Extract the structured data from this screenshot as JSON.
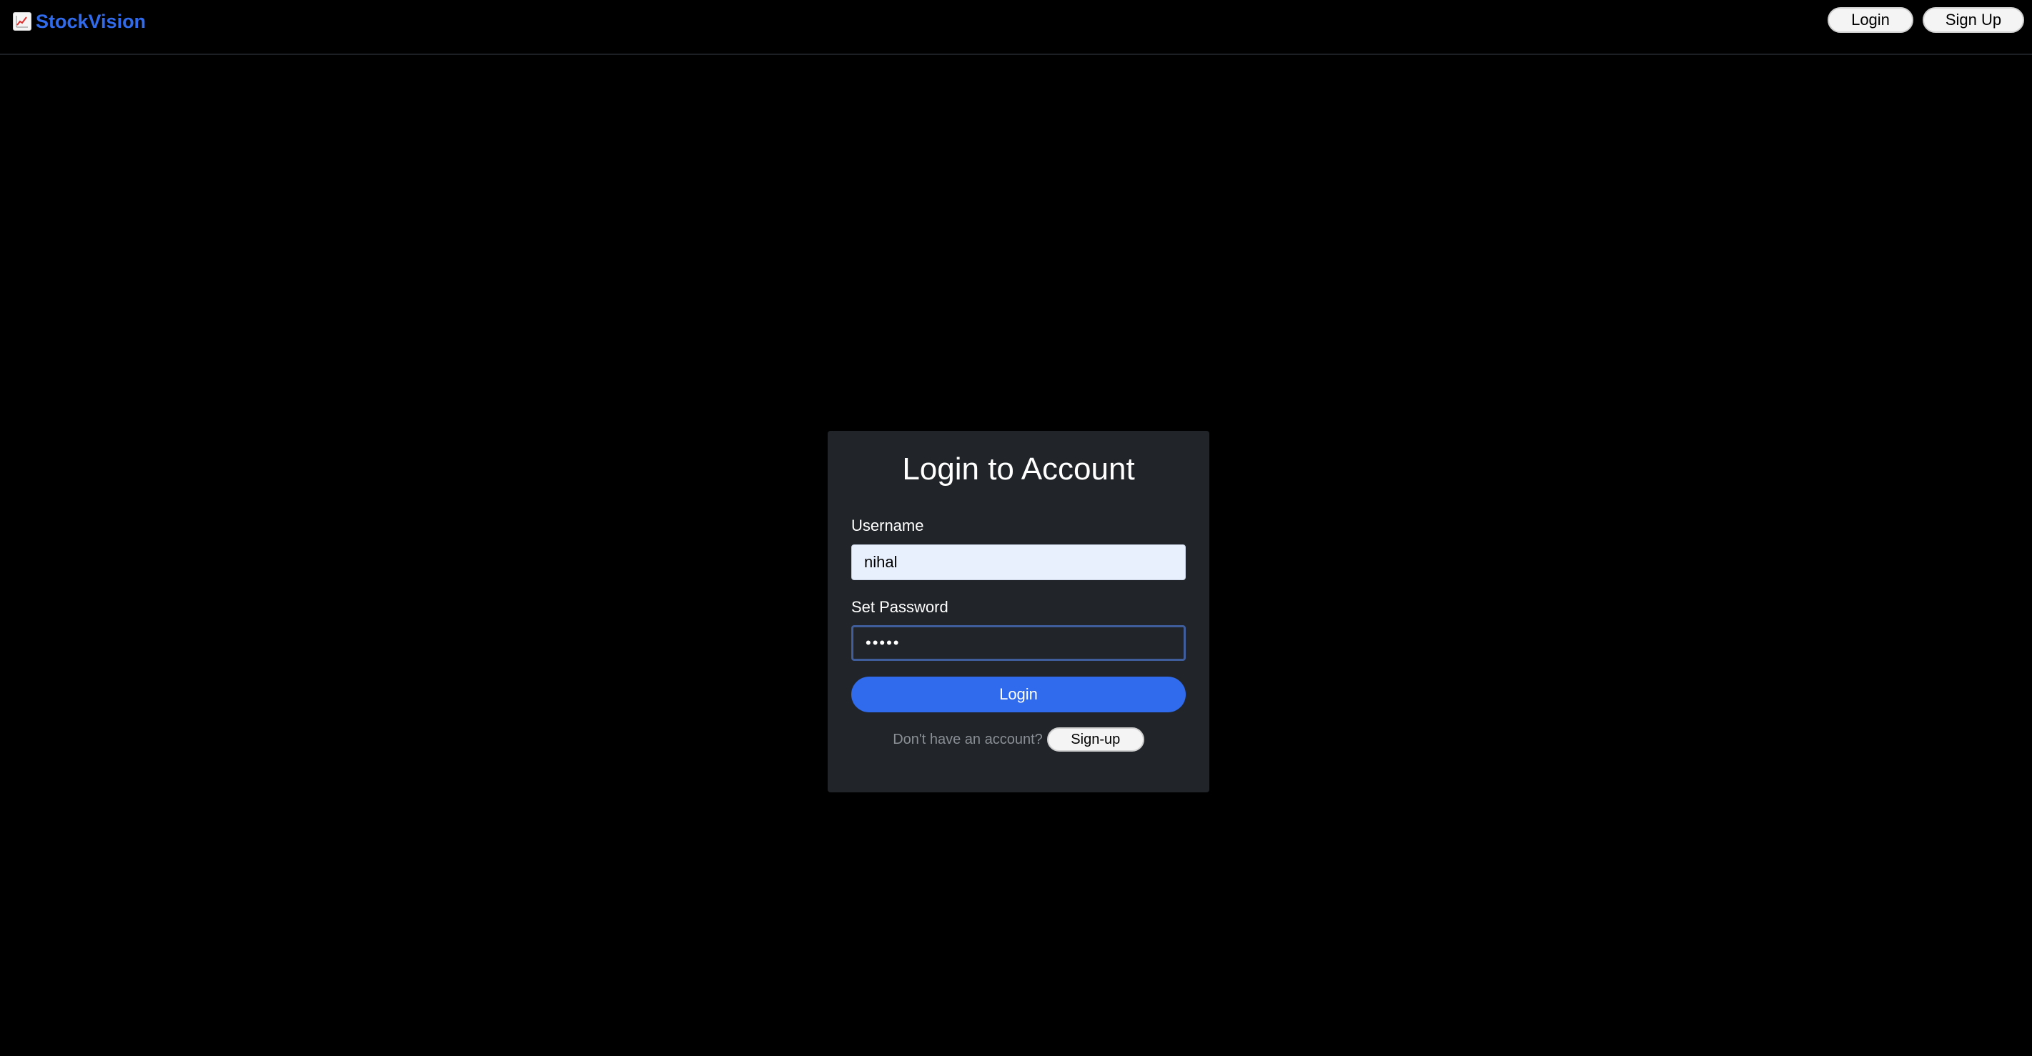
{
  "navbar": {
    "brand_icon": "chart-increasing-icon",
    "brand_name": "StockVision",
    "login_label": "Login",
    "signup_label": "Sign Up"
  },
  "login_form": {
    "title": "Login to Account",
    "username_label": "Username",
    "username_value": "nihal",
    "password_label": "Set Password",
    "password_value": "•••••",
    "submit_label": "Login",
    "no_account_text": "Don't have an account?",
    "signup_link_label": "Sign-up"
  },
  "colors": {
    "accent": "#2f6bec",
    "background": "#000000",
    "card": "#212529"
  }
}
